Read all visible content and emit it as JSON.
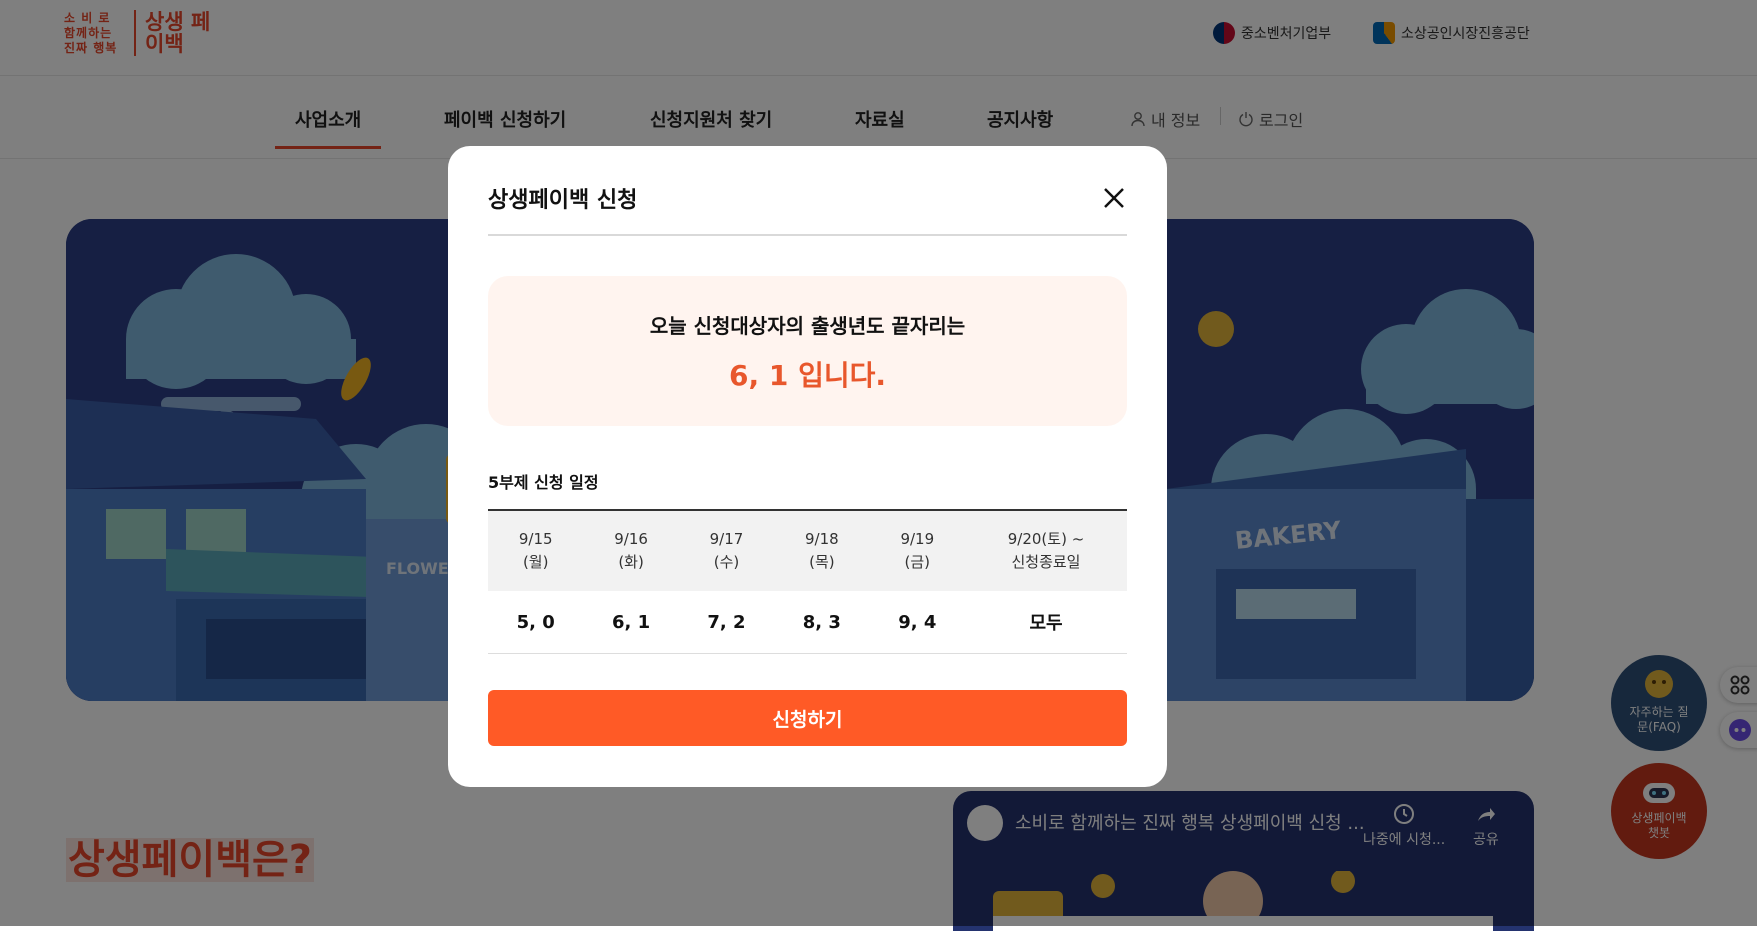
{
  "header": {
    "logo_small": "소 비 로 함께하는 진짜 행복",
    "logo_big": "상생 페이백",
    "gov_links": [
      "중소벤처기업부",
      "소상공인시장진흥공단"
    ]
  },
  "nav": {
    "items": [
      "사업소개",
      "페이백 신청하기",
      "신청지원처 찾기",
      "자료실",
      "공지사항"
    ],
    "my_info": "내 정보",
    "login": "로그인"
  },
  "page": {
    "section_title": "상생페이백은?",
    "video_title": "소비로 함께하는 진짜 행복 상생페이백 신청 ...",
    "video_later": "나중에 시청...",
    "video_share": "공유"
  },
  "floating": {
    "faq": "자주하는 질문(FAQ)",
    "chatbot": "상생페이백 챗봇"
  },
  "modal": {
    "title": "상생페이백 신청",
    "notice_line1": "오늘 신청대상자의 출생년도 끝자리는",
    "notice_line2": "6, 1 입니다.",
    "schedule_label": "5부제 신청 일정",
    "schedule": {
      "headers": [
        "9/15\n(월)",
        "9/16\n(화)",
        "9/17\n(수)",
        "9/18\n(목)",
        "9/19\n(금)",
        "9/20(토) ~\n신청종료일"
      ],
      "values": [
        "5, 0",
        "6, 1",
        "7, 2",
        "8, 3",
        "9, 4",
        "모두"
      ]
    },
    "apply_button": "신청하기"
  },
  "colors": {
    "brand": "#e8472a",
    "apply_button": "#ff5a26",
    "notice_bg": "#fff4ef"
  }
}
